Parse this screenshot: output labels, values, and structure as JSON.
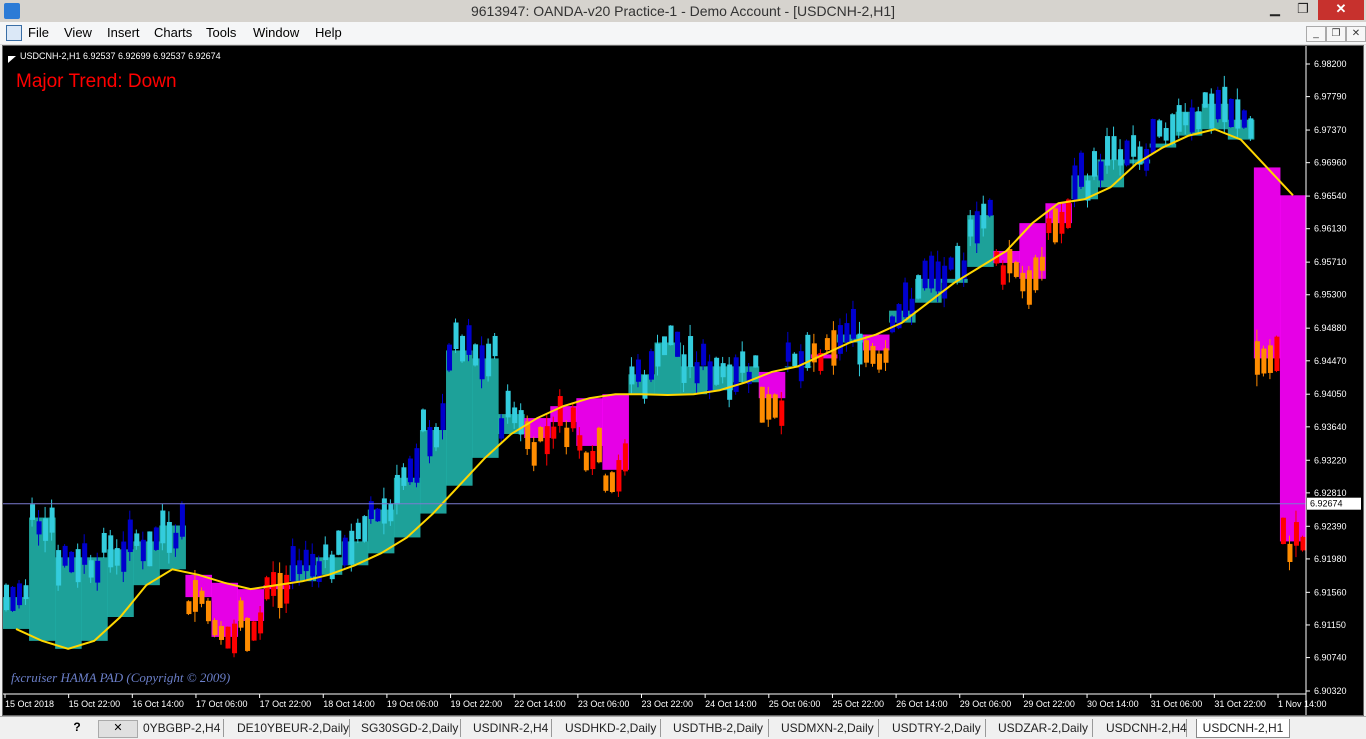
{
  "window": {
    "title": "9613947: OANDA-v20 Practice-1 - Demo Account - [USDCNH-2,H1]",
    "min_label": "▁",
    "max_label": "❐",
    "close_label": "✕",
    "mdi_min": "_",
    "mdi_restore": "❐",
    "mdi_close": "✕"
  },
  "menu": [
    "File",
    "View",
    "Insert",
    "Charts",
    "Tools",
    "Window",
    "Help"
  ],
  "chart": {
    "header": "USDCNH-2,H1  6.92537 6.92699 6.92537 6.92674",
    "trend_label": "Major Trend: Down",
    "watermark": "fxcruiser HAMA PAD (Copyright © 2009)",
    "current_price": "6.92674",
    "colors": {
      "background": "#000000",
      "bull_strong": "#0000cd",
      "bull_weak": "#33ccdd",
      "bear_strong": "#ff0000",
      "bear_weak": "#ff8c00",
      "fill_bull": "#20b2aa",
      "fill_bear": "#ff00ff",
      "ma": "#ffd700",
      "trend_text": "#ff0000",
      "watermark": "#6b7fc9",
      "price_line": "#7b7bd1"
    }
  },
  "chart_data": {
    "type": "candlestick",
    "y_ticks": [
      "6.98200",
      "6.97790",
      "6.97370",
      "6.96960",
      "6.96540",
      "6.96130",
      "6.95710",
      "6.95300",
      "6.94880",
      "6.94470",
      "6.94050",
      "6.93640",
      "6.93220",
      "6.92810",
      "6.92390",
      "6.91980",
      "6.91560",
      "6.91150",
      "6.90740",
      "6.90320"
    ],
    "ylim": [
      6.9032,
      6.982
    ],
    "x_ticks": [
      "15 Oct 2018",
      "15 Oct 22:00",
      "16 Oct 14:00",
      "17 Oct 06:00",
      "17 Oct 22:00",
      "18 Oct 14:00",
      "19 Oct 06:00",
      "19 Oct 22:00",
      "22 Oct 14:00",
      "23 Oct 06:00",
      "23 Oct 22:00",
      "24 Oct 14:00",
      "25 Oct 06:00",
      "25 Oct 22:00",
      "26 Oct 14:00",
      "29 Oct 06:00",
      "29 Oct 22:00",
      "30 Oct 14:00",
      "31 Oct 06:00",
      "31 Oct 22:00",
      "1 Nov 14:00"
    ],
    "ma_points": [
      6.911,
      6.9095,
      6.9085,
      6.9095,
      6.9125,
      6.9165,
      6.9185,
      6.9178,
      6.9168,
      6.916,
      6.9165,
      6.917,
      6.9178,
      6.919,
      6.9205,
      6.9225,
      6.9255,
      6.929,
      6.9325,
      6.9355,
      6.9375,
      6.939,
      6.94,
      6.9405,
      6.9405,
      6.9404,
      6.9405,
      6.941,
      6.942,
      6.9433,
      6.944,
      6.9455,
      6.947,
      6.948,
      6.9495,
      6.952,
      6.9545,
      6.9565,
      6.9585,
      6.962,
      6.9645,
      6.965,
      6.9665,
      6.9695,
      6.9715,
      6.973,
      6.9738,
      6.9725,
      6.969,
      6.9655
    ],
    "series": [
      {
        "name": "",
        "values": [
          6.915,
          6.925,
          6.92,
          6.92,
          6.921,
          6.922,
          6.924,
          6.915,
          6.91,
          6.912,
          6.916,
          6.919,
          6.92,
          6.922,
          6.926,
          6.93,
          6.936,
          6.946,
          6.945,
          6.938,
          6.935,
          6.937,
          6.934,
          6.931,
          6.943,
          6.947,
          6.944,
          6.944,
          6.944,
          6.94,
          6.944,
          6.945,
          6.948,
          6.946,
          6.951,
          6.955,
          6.955,
          6.963,
          6.957,
          6.955,
          6.962,
          6.968,
          6.97,
          6.97,
          6.972,
          6.976,
          6.977,
          6.975,
          6.945,
          6.922
        ]
      }
    ]
  },
  "tabs": {
    "help": "?",
    "close": "✕",
    "items": [
      "0YBGBP-2,H4",
      "DE10YBEUR-2,Daily",
      "SG30SGD-2,Daily",
      "USDINR-2,H4",
      "USDHKD-2,Daily",
      "USDTHB-2,Daily",
      "USDMXN-2,Daily",
      "USDTRY-2,Daily",
      "USDZAR-2,Daily",
      "USDCNH-2,H4",
      "USDCNH-2,H1"
    ],
    "active": "USDCNH-2,H1"
  }
}
